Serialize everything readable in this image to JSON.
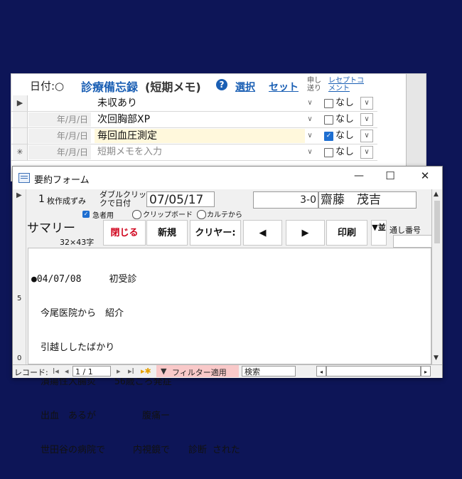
{
  "back_form": {
    "header": {
      "date_label": "日付:○",
      "title": "診療備忘録",
      "subtitle": "(短期メモ)",
      "help_icon": "?",
      "select_link": "選択",
      "set_link": "セット",
      "mosi_label": "申し送り",
      "receipt_comment_label": "レセプトコメント"
    },
    "rows": [
      {
        "selector": "▶",
        "date": "",
        "memo": "未収あり",
        "checked": false,
        "nashi": "なし"
      },
      {
        "selector": "",
        "date": "年/月/日",
        "memo": "次回胸部XP",
        "checked": false,
        "nashi": "なし"
      },
      {
        "selector": "",
        "date": "年/月/日",
        "memo": "毎回血圧測定",
        "checked": true,
        "nashi": "なし"
      },
      {
        "selector": "✳",
        "date": "年/月/日",
        "memo": "短期メモを入力",
        "checked": false,
        "nashi": "なし",
        "placeholder": true
      }
    ]
  },
  "front_form": {
    "window_title": "要約フォーム",
    "controls": {
      "minimize": "—",
      "maximize": "☐",
      "close": "✕"
    },
    "record_num": "1",
    "created_label": "枚作成ずみ",
    "double_click_label": "ダブルクリックで日付",
    "date_value": "07/05/17",
    "patient_id": "3-0",
    "patient_name": "齋藤　茂吉",
    "urgent_label": "急者用",
    "clipboard_label": "クリップボード",
    "karte_label": "カルテから",
    "summary_label": "サマリー",
    "char_limit": "32×43字",
    "buttons": {
      "close": "閉じる",
      "new": "新規",
      "clear": "クリヤー:",
      "prev": "◀",
      "next": "▶",
      "print": "印刷",
      "sort": "▼並"
    },
    "serial_label": "通し番号",
    "summary_lines": [
      "●04/07/08　　　初受診",
      "　今尾医院から　紹介",
      "　引越ししたばかり",
      "　潰瘍性大腸炎　　56歳ころ発症",
      "　出血　あるが　　　　　腹痛ー",
      "　世田谷の病院で　　　内視鏡で　　診断 された"
    ],
    "ruler_marks": {
      "mark5": "5",
      "mark0": "0"
    },
    "navbar": {
      "record_label": "レコード:",
      "record_value": "1 / 1",
      "filter_label": "フィルター適用",
      "search_label": "検索"
    }
  },
  "colors": {
    "background": "#0d1557",
    "link_blue": "#1a5fb4",
    "close_red": "#d0021b",
    "check_blue": "#1f6fd1",
    "highlight_row": "#fff8dc"
  }
}
